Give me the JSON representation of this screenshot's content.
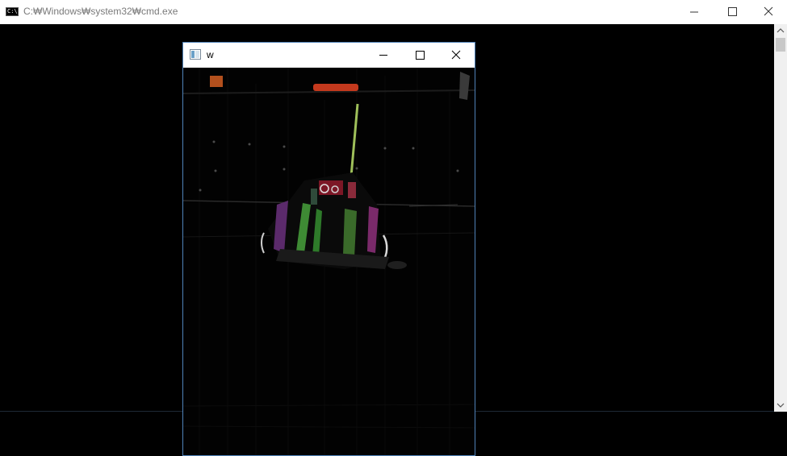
{
  "console_window": {
    "title": "C:₩Windows₩system32₩cmd.exe",
    "icon": "cmd-icon",
    "icon_text": "C:\\",
    "controls": [
      "minimize-icon",
      "maximize-icon",
      "close-icon"
    ],
    "colors": {
      "titlebar": "#ffffff",
      "title_text": "#7a7a7a",
      "background": "#000000"
    }
  },
  "image_window": {
    "title": "w",
    "icon": "image-window-icon",
    "controls": [
      "minimize-icon",
      "maximize-icon",
      "close-icon"
    ],
    "content": "dark edge-detected frame of a vehicle with colored lights",
    "colors": {
      "border": "#4f82b8",
      "titlebar": "#ffffff"
    }
  },
  "scrollbar": {
    "orientation": "vertical"
  }
}
